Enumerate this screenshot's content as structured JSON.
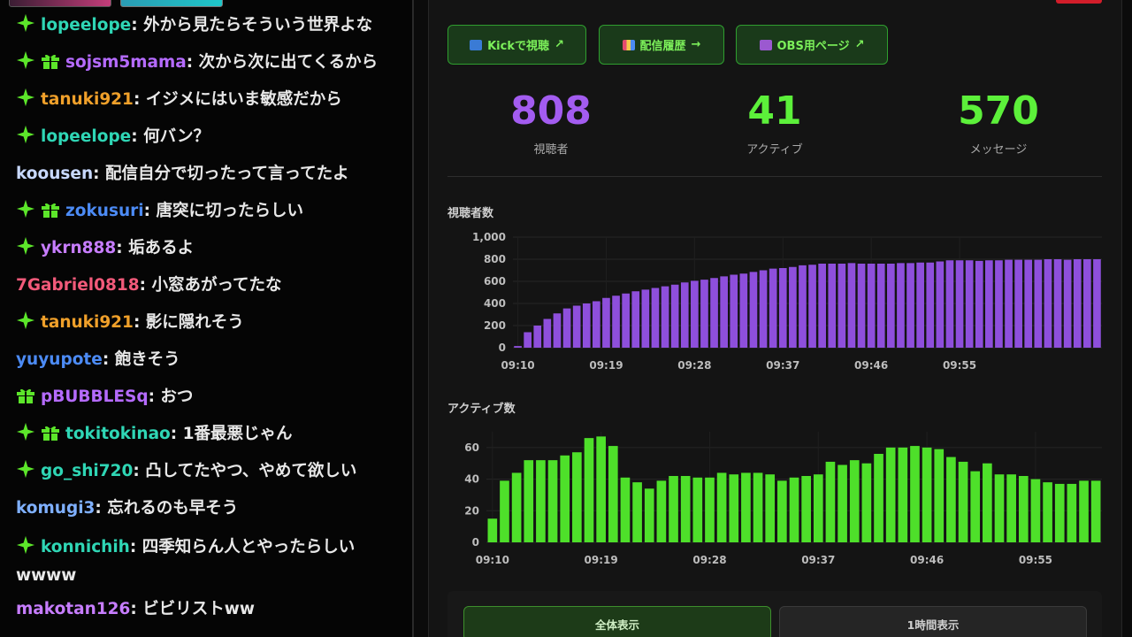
{
  "chat": {
    "messages": [
      {
        "badges": [
          "star"
        ],
        "user": "lopeelope",
        "color": "#2fd6b5",
        "text": "外から見たらそういう世界よな"
      },
      {
        "badges": [
          "star",
          "gift"
        ],
        "user": "sojsm5mama",
        "color": "#b56bff",
        "text": "次から次に出てくるから"
      },
      {
        "badges": [
          "star"
        ],
        "user": "tanuki921",
        "color": "#f0a02a",
        "text": "イジメにはいま敏感だから"
      },
      {
        "badges": [
          "star"
        ],
        "user": "lopeelope",
        "color": "#2fd6b5",
        "text": "何バン？"
      },
      {
        "badges": [],
        "user": "koousen",
        "color": "#c8d9ff",
        "text": "配信自分で切ったって言ってたよ"
      },
      {
        "badges": [
          "star",
          "gift"
        ],
        "user": "zokusuri",
        "color": "#4c8bf5",
        "text": "唐突に切ったらしい"
      },
      {
        "badges": [
          "star"
        ],
        "user": "ykrn888",
        "color": "#c77dff",
        "text": "垢あるよ"
      },
      {
        "badges": [],
        "user": "7Gabriel0818",
        "color": "#f25a7a",
        "text": "小窓あがってたな"
      },
      {
        "badges": [
          "star"
        ],
        "user": "tanuki921",
        "color": "#f0a02a",
        "text": "影に隠れそう"
      },
      {
        "badges": [],
        "user": "yuyupote",
        "color": "#4c8bf5",
        "text": "飽きそう"
      },
      {
        "badges": [
          "gift"
        ],
        "user": "pBUBBLESq",
        "color": "#b56bff",
        "text": "おつ"
      },
      {
        "badges": [
          "star",
          "gift"
        ],
        "user": "tokitokinao",
        "color": "#2fd6b5",
        "text": "1番最悪じゃん"
      },
      {
        "badges": [
          "star"
        ],
        "user": "go_shi720",
        "color": "#2fd6b5",
        "text": "凸してたやつ、やめて欲しい"
      },
      {
        "badges": [],
        "user": "komugi3",
        "color": "#7fb0ff",
        "text": "忘れるのも早そう"
      },
      {
        "badges": [
          "star"
        ],
        "user": "konnichih",
        "color": "#2fd6b5",
        "text": "四季知らん人とやったらしい wwww"
      },
      {
        "badges": [],
        "user": "makotan126",
        "color": "#c77dff",
        "text": "ビビリストww"
      }
    ]
  },
  "buttons": {
    "kick": "Kickで視聴",
    "history": "配信履歴",
    "obs": "OBS用ページ",
    "arrow_out": "↗",
    "arrow_right": "→"
  },
  "stats": {
    "viewers": {
      "value": "808",
      "label": "視聴者",
      "color": "#a35cf0"
    },
    "active": {
      "value": "41",
      "label": "アクティブ",
      "color": "#5cf03a"
    },
    "messages": {
      "value": "570",
      "label": "メッセージ",
      "color": "#5cf03a"
    }
  },
  "chart_data": [
    {
      "type": "bar",
      "title": "視聴者数",
      "color": "#8e4fdc",
      "ylim": [
        0,
        1000
      ],
      "yticks": [
        "1,000",
        "800",
        "600",
        "400",
        "200",
        "0"
      ],
      "ytick_values": [
        1000,
        800,
        600,
        400,
        200,
        0
      ],
      "xticks": [
        "09:10",
        "09:19",
        "09:28",
        "09:37",
        "09:46",
        "09:55"
      ],
      "values": [
        15,
        140,
        200,
        260,
        310,
        355,
        380,
        400,
        420,
        450,
        470,
        490,
        510,
        525,
        540,
        555,
        570,
        590,
        605,
        615,
        630,
        645,
        660,
        670,
        685,
        700,
        715,
        720,
        730,
        745,
        750,
        760,
        760,
        760,
        765,
        760,
        760,
        760,
        760,
        765,
        765,
        770,
        770,
        780,
        790,
        790,
        790,
        785,
        790,
        790,
        795,
        795,
        795,
        795,
        800,
        800,
        795,
        800,
        800,
        800
      ]
    },
    {
      "type": "bar",
      "title": "アクティブ数",
      "color": "#4ee02a",
      "ylim": [
        0,
        70
      ],
      "yticks": [
        "60",
        "40",
        "20",
        "0"
      ],
      "ytick_values": [
        60,
        40,
        20,
        0
      ],
      "xticks": [
        "09:10",
        "09:19",
        "09:28",
        "09:37",
        "09:46",
        "09:55"
      ],
      "values": [
        15,
        39,
        44,
        52,
        52,
        52,
        55,
        57,
        66,
        67,
        61,
        41,
        38,
        34,
        39,
        42,
        42,
        41,
        41,
        44,
        43,
        44,
        44,
        43,
        39,
        41,
        42,
        43,
        51,
        49,
        52,
        50,
        56,
        60,
        60,
        61,
        60,
        59,
        54,
        51,
        45,
        50,
        43,
        43,
        42,
        40,
        38,
        37,
        37,
        39,
        39
      ]
    }
  ],
  "bottom": {
    "all_view": "全体表示",
    "one_hour": "1時間表示"
  }
}
